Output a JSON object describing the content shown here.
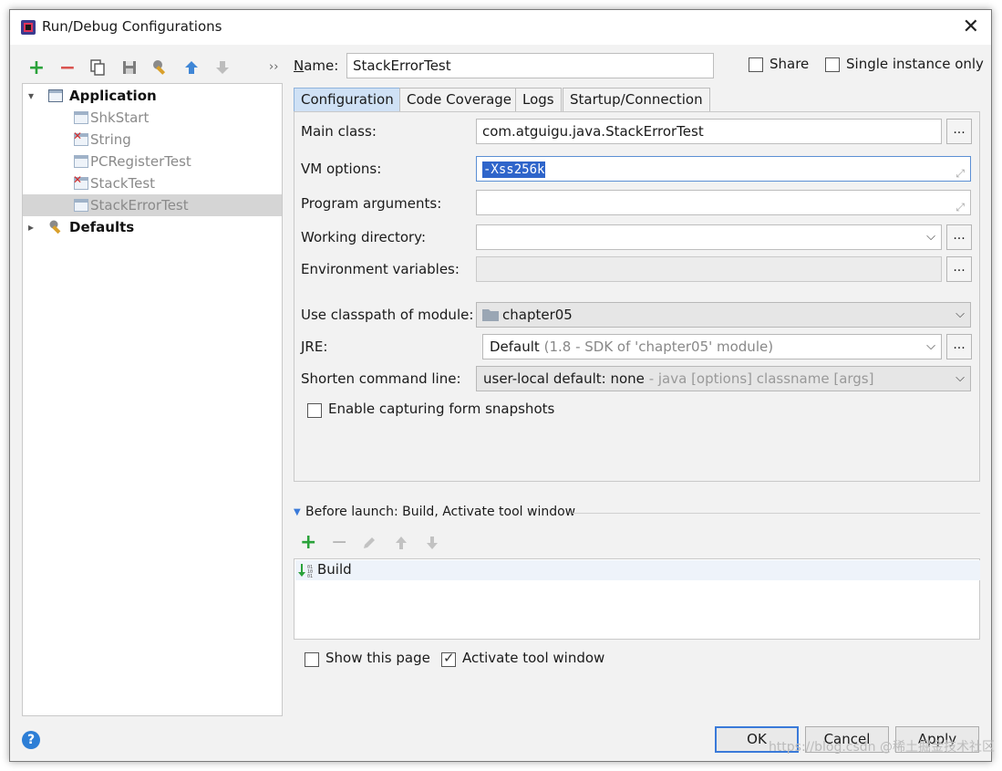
{
  "window": {
    "title": "Run/Debug Configurations"
  },
  "toolbar": {
    "add": "+",
    "remove": "−",
    "copy": "copy",
    "save": "save",
    "edit": "edit",
    "up": "↑",
    "down": "↓",
    "more": "››"
  },
  "tree": {
    "application": "Application",
    "items": [
      "ShkStart",
      "String",
      "PCRegisterTest",
      "StackTest",
      "StackErrorTest"
    ],
    "defaults": "Defaults"
  },
  "name_label": "Name:",
  "name_value": "StackErrorTest",
  "share_label": "Share",
  "single_instance_label": "Single instance only",
  "tabs": [
    "Configuration",
    "Code Coverage",
    "Logs",
    "Startup/Connection"
  ],
  "form": {
    "main_class_label": "Main class:",
    "main_class_value": "com.atguigu.java.StackErrorTest",
    "vm_options_label": "VM options:",
    "vm_options_value": "-Xss256k",
    "program_args_label": "Program arguments:",
    "working_dir_label": "Working directory:",
    "env_vars_label": "Environment variables:",
    "classpath_label": "Use classpath of module:",
    "classpath_value": "chapter05",
    "jre_label": "JRE:",
    "jre_value": "Default",
    "jre_detail": "(1.8 - SDK of 'chapter05' module)",
    "shorten_label": "Shorten command line:",
    "shorten_value": "user-local default: none",
    "shorten_detail": "- java [options] classname [args]",
    "snapshots_label": "Enable capturing form snapshots",
    "browse": "..."
  },
  "before_launch": {
    "title": "Before launch: Build, Activate tool window",
    "items": [
      "Build"
    ]
  },
  "show_page_label": "Show this page",
  "activate_label": "Activate tool window",
  "buttons": {
    "ok": "OK",
    "cancel": "Cancel",
    "apply": "Apply",
    "help": "?"
  },
  "watermark": "https://blog.csdn @稀土掘金技术社区",
  "colors": {
    "selection": "#2f65ca",
    "active_tab": "#cfe1f5",
    "help": "#2d7ed6",
    "add_green": "#2aa23a",
    "remove_red": "#d9534f"
  }
}
